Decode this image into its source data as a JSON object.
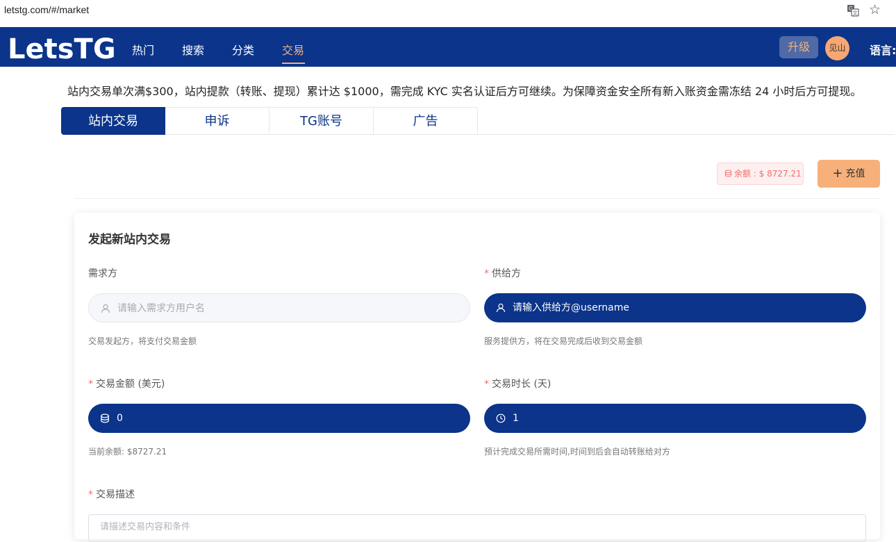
{
  "browser": {
    "url": "letstg.com/#/market"
  },
  "nav": {
    "logo": "LetsTG",
    "items": [
      {
        "label": "热门",
        "active": false
      },
      {
        "label": "搜索",
        "active": false
      },
      {
        "label": "分类",
        "active": false
      },
      {
        "label": "交易",
        "active": true
      }
    ],
    "upgrade": "升级",
    "avatar": "见山",
    "language": "语言:"
  },
  "notice": "站内交易单次满$300，站内提款（转账、提现）累计达 $1000，需完成 KYC 实名认证后方可继续。为保障资金安全所有新入账资金需冻结 24 小时后方可提现。",
  "tabs": [
    {
      "label": "站内交易",
      "active": true
    },
    {
      "label": "申诉",
      "active": false
    },
    {
      "label": "TG账号",
      "active": false
    },
    {
      "label": "广告",
      "active": false
    }
  ],
  "balance": {
    "text": "余额 : $ 8727.21"
  },
  "recharge": {
    "label": "充值"
  },
  "form": {
    "title": "发起新站内交易",
    "demander": {
      "label": "需求方",
      "placeholder": "请输入需求方用户名",
      "hint": "交易发起方，将支付交易金额"
    },
    "supplier": {
      "label": "供给方",
      "placeholder": "请输入供给方@username",
      "hint": "服务提供方，将在交易完成后收到交易金额"
    },
    "amount": {
      "label": "交易金额 (美元)",
      "value": "0",
      "hint": "当前余额: $8727.21"
    },
    "duration": {
      "label": "交易时长 (天)",
      "value": "1",
      "hint": "预计完成交易所需时间,时间到后会自动转账给对方"
    },
    "description": {
      "label": "交易描述",
      "placeholder": "请描述交易内容和条件"
    }
  },
  "colors": {
    "primary": "#0b348a",
    "accent": "#f7b07a",
    "danger": "#f56c6c"
  }
}
